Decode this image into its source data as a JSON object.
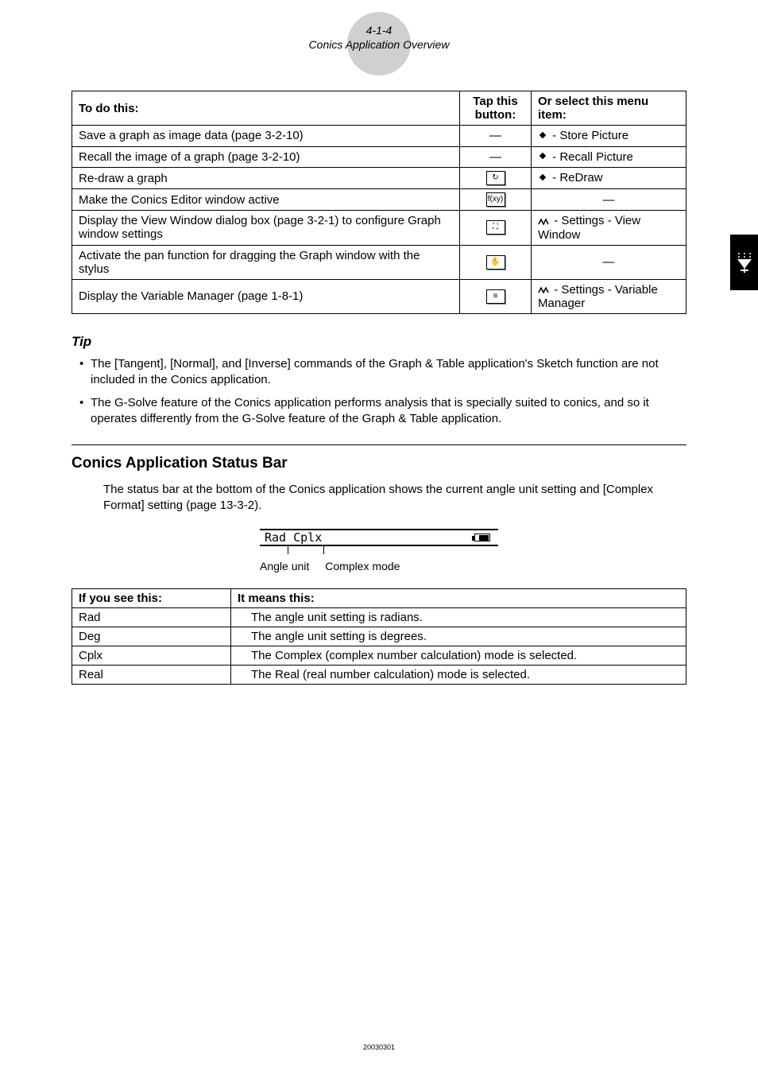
{
  "header": {
    "page_number": "4-1-4",
    "subtitle": "Conics Application Overview"
  },
  "main_table": {
    "headers": {
      "todo": "To do this:",
      "tap": "Tap this button:",
      "menu": "Or select this menu item:"
    },
    "rows": [
      {
        "todo": "Save a graph as image data (page 3-2-10)",
        "button": "—",
        "button_type": "dash",
        "menu": " - Store Picture",
        "menu_icon": "diamond"
      },
      {
        "todo": "Recall the image of a graph (page 3-2-10)",
        "button": "—",
        "button_type": "dash",
        "menu": " - Recall Picture",
        "menu_icon": "diamond"
      },
      {
        "todo": "Re-draw a graph",
        "button": "↻",
        "button_type": "box",
        "menu": " - ReDraw",
        "menu_icon": "diamond"
      },
      {
        "todo": "Make the Conics Editor window active",
        "button": "f(xy)",
        "button_type": "box",
        "menu": "—",
        "menu_icon": "none"
      },
      {
        "todo": "Display the View Window dialog box (page 3-2-1) to configure Graph window settings",
        "button": "⛶",
        "button_type": "box",
        "menu": " - Settings - View Window",
        "menu_icon": "settings"
      },
      {
        "todo": "Activate the pan function for dragging the Graph window with the stylus",
        "button": "✋",
        "button_type": "box",
        "menu": "—",
        "menu_icon": "none"
      },
      {
        "todo": "Display the Variable Manager (page 1-8-1)",
        "button": "≡",
        "button_type": "box",
        "menu": " - Settings - Variable Manager",
        "menu_icon": "settings"
      }
    ]
  },
  "tip": {
    "heading": "Tip",
    "items": [
      "The [Tangent], [Normal], and [Inverse] commands of the Graph & Table application's Sketch function are not included in the Conics application.",
      "The G-Solve feature of the Conics application performs analysis that is specially suited to conics, and so it operates differently from the G-Solve feature of the Graph & Table application."
    ]
  },
  "section": {
    "heading": "Conics Application Status Bar",
    "para": "The status bar at the bottom of the Conics application shows the current angle unit setting and [Complex Format] setting (page 13-3-2)."
  },
  "status_bar": {
    "text": "Rad  Cplx",
    "label_angle": "Angle unit",
    "label_complex": "Complex mode"
  },
  "status_table": {
    "headers": {
      "see": "If you see this:",
      "means": "It means this:"
    },
    "rows": [
      {
        "see": "Rad",
        "means": "The angle unit setting is radians."
      },
      {
        "see": "Deg",
        "means": "The angle unit setting is degrees."
      },
      {
        "see": "Cplx",
        "means": "The Complex (complex number calculation) mode is selected."
      },
      {
        "see": "Real",
        "means": "The Real (real number calculation) mode is selected."
      }
    ]
  },
  "footer": "20030301"
}
